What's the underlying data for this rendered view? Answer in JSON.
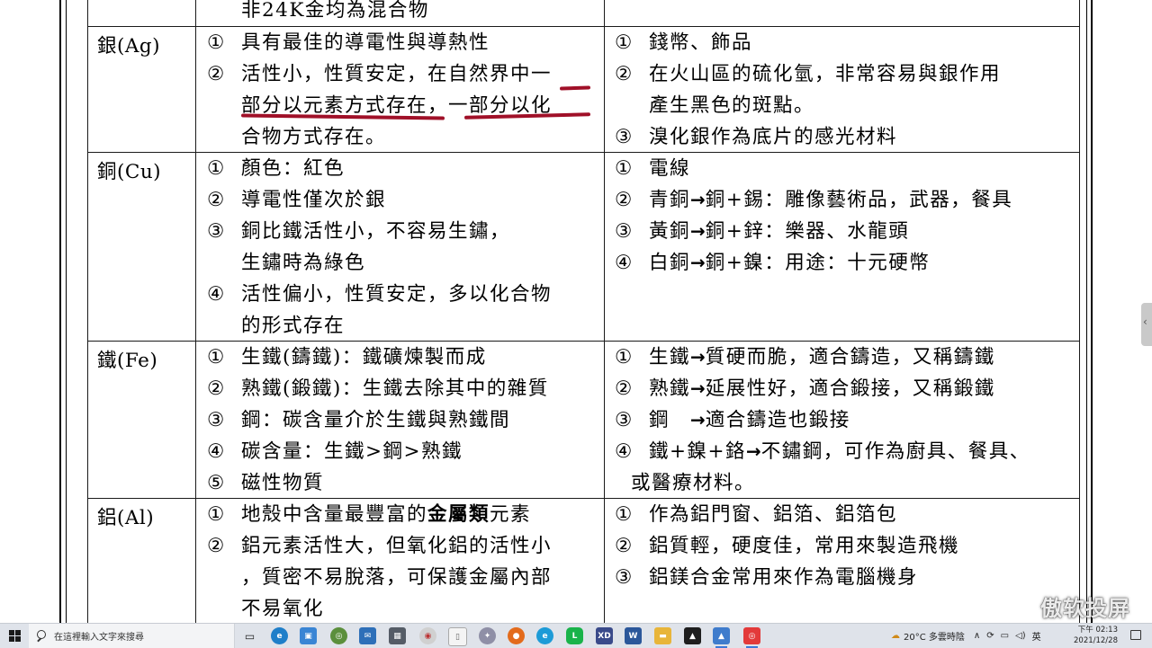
{
  "table": {
    "top_row": {
      "props_cont": "非24K金均為混合物"
    },
    "rows": [
      {
        "element": "銀(Ag)",
        "props": [
          {
            "marker": "①",
            "text": "具有最佳的導電性與導熱性"
          },
          {
            "marker": "②",
            "text": "活性小，性質安定，在自然界中一"
          },
          {
            "marker": "",
            "text": "部分以元素方式存在，一部分以化"
          },
          {
            "marker": "",
            "text": "合物方式存在。"
          }
        ],
        "uses": [
          {
            "marker": "①",
            "text": "錢幣、飾品"
          },
          {
            "marker": "②",
            "text": "在火山區的硫化氫，非常容易與銀作用"
          },
          {
            "marker": "",
            "text": "產生黑色的斑點。"
          },
          {
            "marker": "③",
            "text": "溴化銀作為底片的感光材料"
          }
        ]
      },
      {
        "element": "銅(Cu)",
        "props": [
          {
            "marker": "①",
            "text": "顏色：紅色"
          },
          {
            "marker": "②",
            "text": "導電性僅次於銀"
          },
          {
            "marker": "③",
            "text": "銅比鐵活性小，不容易生鏽，"
          },
          {
            "marker": "",
            "text": "生鏽時為綠色"
          },
          {
            "marker": "④",
            "text": "活性偏小，性質安定，多以化合物"
          },
          {
            "marker": "",
            "text": "的形式存在"
          }
        ],
        "uses": [
          {
            "marker": "①",
            "text": "電線"
          },
          {
            "marker": "②",
            "pre": "青銅",
            "arrow": "→",
            "post": "銅+錫：雕像藝術品，武器，餐具"
          },
          {
            "marker": "③",
            "pre": "黃銅",
            "arrow": "→",
            "post": "銅+鋅：樂器、水龍頭"
          },
          {
            "marker": "④",
            "pre": "白銅",
            "arrow": "→",
            "post": "銅+鎳：用途：十元硬幣"
          }
        ]
      },
      {
        "element": "鐵(Fe)",
        "props": [
          {
            "marker": "①",
            "text": "生鐵(鑄鐵)：鐵礦煉製而成"
          },
          {
            "marker": "②",
            "text": "熟鐵(鍛鐵)：生鐵去除其中的雜質"
          },
          {
            "marker": "③",
            "text": "鋼：碳含量介於生鐵與熟鐵間"
          },
          {
            "marker": "④",
            "text": "碳含量：生鐵>鋼>熟鐵"
          },
          {
            "marker": "⑤",
            "text": "磁性物質"
          }
        ],
        "uses": [
          {
            "marker": "①",
            "pre": "生鐵",
            "arrow": "→",
            "post": "質硬而脆，適合鑄造，又稱鑄鐵"
          },
          {
            "marker": "②",
            "pre": "熟鐵",
            "arrow": "→",
            "post": "延展性好，適合鍛接，又稱鍛鐵"
          },
          {
            "marker": "③",
            "pre": "鋼　",
            "arrow": "→",
            "post": "適合鑄造也鍛接"
          },
          {
            "marker": "④",
            "pre": "鐵+鎳+鉻",
            "arrow": "→",
            "post": "不鏽鋼，可作為廚具、餐具、"
          },
          {
            "marker": "",
            "text": "或醫療材料。"
          }
        ]
      },
      {
        "element": "鋁(Al)",
        "props": [
          {
            "marker": "①",
            "pre": "地殼中含量最豐富的",
            "bold": "金屬類",
            "post": "元素"
          },
          {
            "marker": "②",
            "text": "鋁元素活性大，但氧化鋁的活性小"
          },
          {
            "marker": "",
            "text": "，質密不易脫落，可保護金屬內部"
          },
          {
            "marker": "",
            "text": "不易氧化"
          }
        ],
        "uses": [
          {
            "marker": "①",
            "text": "作為鋁門窗、鋁箔、鋁箔包"
          },
          {
            "marker": "②",
            "text": "鋁質輕，硬度佳，常用來製造飛機"
          },
          {
            "marker": "③",
            "text": "鋁鎂合金常用來作為電腦機身"
          }
        ]
      }
    ]
  },
  "watermark": "傲软投屏",
  "taskbar": {
    "search_placeholder": "在這裡輸入文字來搜尋",
    "weather": "20°C 多雲時陰",
    "ime": "英",
    "time": "下午 02:13",
    "date": "2021/12/28",
    "apps": [
      "task-view",
      "edge",
      "store",
      "chrome-like",
      "mail",
      "calculator",
      "files",
      "paint",
      "edge-2",
      "line",
      "word-xd",
      "word",
      "folder",
      "terminal",
      "photos",
      "screen-mirror"
    ]
  },
  "colors": {
    "annotation": "#a01028",
    "taskbar": "#dfe3ea",
    "accent": "#3b78d8"
  }
}
